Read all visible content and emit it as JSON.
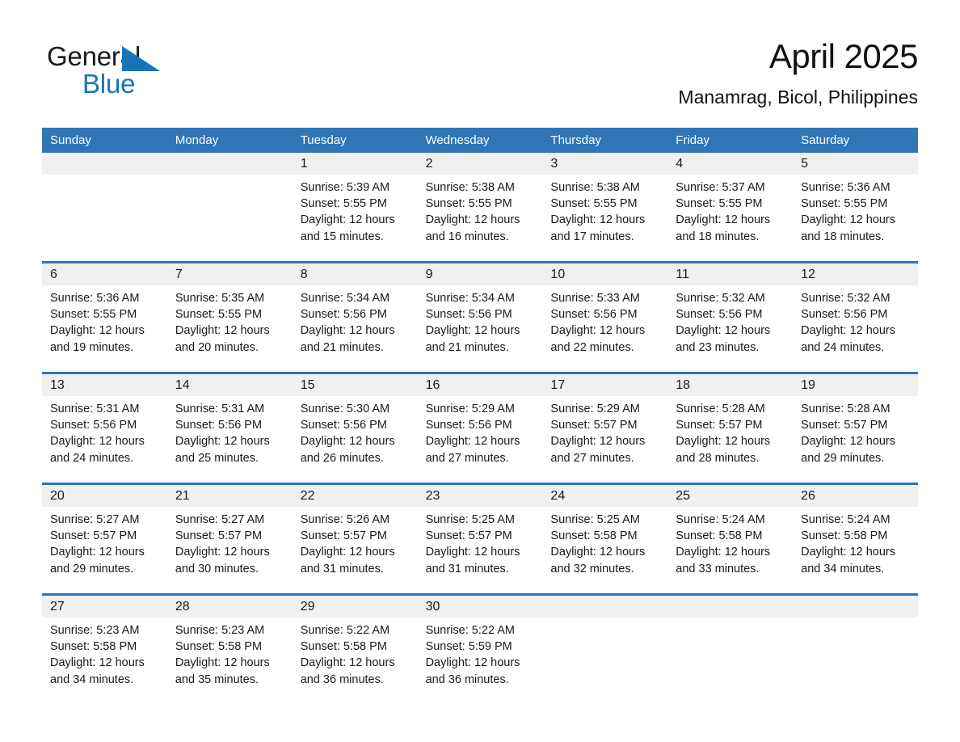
{
  "brand": {
    "name_part1": "General",
    "name_part2": "Blue",
    "triangle_icon": "triangle-icon",
    "accent_color": "#1874b8"
  },
  "header": {
    "title": "April 2025",
    "location": "Manamrag, Bicol, Philippines"
  },
  "colors": {
    "header_blue": "#3075b5",
    "rule_blue": "#2e74b5",
    "daynum_band": "#f0f0f0",
    "text": "#1a1a1a"
  },
  "weekdays": [
    "Sunday",
    "Monday",
    "Tuesday",
    "Wednesday",
    "Thursday",
    "Friday",
    "Saturday"
  ],
  "weeks": [
    {
      "days": [
        {
          "num": "",
          "sunrise": "",
          "sunset": "",
          "daylight_l1": "",
          "daylight_l2": ""
        },
        {
          "num": "",
          "sunrise": "",
          "sunset": "",
          "daylight_l1": "",
          "daylight_l2": ""
        },
        {
          "num": "1",
          "sunrise": "Sunrise: 5:39 AM",
          "sunset": "Sunset: 5:55 PM",
          "daylight_l1": "Daylight: 12 hours",
          "daylight_l2": "and 15 minutes."
        },
        {
          "num": "2",
          "sunrise": "Sunrise: 5:38 AM",
          "sunset": "Sunset: 5:55 PM",
          "daylight_l1": "Daylight: 12 hours",
          "daylight_l2": "and 16 minutes."
        },
        {
          "num": "3",
          "sunrise": "Sunrise: 5:38 AM",
          "sunset": "Sunset: 5:55 PM",
          "daylight_l1": "Daylight: 12 hours",
          "daylight_l2": "and 17 minutes."
        },
        {
          "num": "4",
          "sunrise": "Sunrise: 5:37 AM",
          "sunset": "Sunset: 5:55 PM",
          "daylight_l1": "Daylight: 12 hours",
          "daylight_l2": "and 18 minutes."
        },
        {
          "num": "5",
          "sunrise": "Sunrise: 5:36 AM",
          "sunset": "Sunset: 5:55 PM",
          "daylight_l1": "Daylight: 12 hours",
          "daylight_l2": "and 18 minutes."
        }
      ]
    },
    {
      "days": [
        {
          "num": "6",
          "sunrise": "Sunrise: 5:36 AM",
          "sunset": "Sunset: 5:55 PM",
          "daylight_l1": "Daylight: 12 hours",
          "daylight_l2": "and 19 minutes."
        },
        {
          "num": "7",
          "sunrise": "Sunrise: 5:35 AM",
          "sunset": "Sunset: 5:55 PM",
          "daylight_l1": "Daylight: 12 hours",
          "daylight_l2": "and 20 minutes."
        },
        {
          "num": "8",
          "sunrise": "Sunrise: 5:34 AM",
          "sunset": "Sunset: 5:56 PM",
          "daylight_l1": "Daylight: 12 hours",
          "daylight_l2": "and 21 minutes."
        },
        {
          "num": "9",
          "sunrise": "Sunrise: 5:34 AM",
          "sunset": "Sunset: 5:56 PM",
          "daylight_l1": "Daylight: 12 hours",
          "daylight_l2": "and 21 minutes."
        },
        {
          "num": "10",
          "sunrise": "Sunrise: 5:33 AM",
          "sunset": "Sunset: 5:56 PM",
          "daylight_l1": "Daylight: 12 hours",
          "daylight_l2": "and 22 minutes."
        },
        {
          "num": "11",
          "sunrise": "Sunrise: 5:32 AM",
          "sunset": "Sunset: 5:56 PM",
          "daylight_l1": "Daylight: 12 hours",
          "daylight_l2": "and 23 minutes."
        },
        {
          "num": "12",
          "sunrise": "Sunrise: 5:32 AM",
          "sunset": "Sunset: 5:56 PM",
          "daylight_l1": "Daylight: 12 hours",
          "daylight_l2": "and 24 minutes."
        }
      ]
    },
    {
      "days": [
        {
          "num": "13",
          "sunrise": "Sunrise: 5:31 AM",
          "sunset": "Sunset: 5:56 PM",
          "daylight_l1": "Daylight: 12 hours",
          "daylight_l2": "and 24 minutes."
        },
        {
          "num": "14",
          "sunrise": "Sunrise: 5:31 AM",
          "sunset": "Sunset: 5:56 PM",
          "daylight_l1": "Daylight: 12 hours",
          "daylight_l2": "and 25 minutes."
        },
        {
          "num": "15",
          "sunrise": "Sunrise: 5:30 AM",
          "sunset": "Sunset: 5:56 PM",
          "daylight_l1": "Daylight: 12 hours",
          "daylight_l2": "and 26 minutes."
        },
        {
          "num": "16",
          "sunrise": "Sunrise: 5:29 AM",
          "sunset": "Sunset: 5:56 PM",
          "daylight_l1": "Daylight: 12 hours",
          "daylight_l2": "and 27 minutes."
        },
        {
          "num": "17",
          "sunrise": "Sunrise: 5:29 AM",
          "sunset": "Sunset: 5:57 PM",
          "daylight_l1": "Daylight: 12 hours",
          "daylight_l2": "and 27 minutes."
        },
        {
          "num": "18",
          "sunrise": "Sunrise: 5:28 AM",
          "sunset": "Sunset: 5:57 PM",
          "daylight_l1": "Daylight: 12 hours",
          "daylight_l2": "and 28 minutes."
        },
        {
          "num": "19",
          "sunrise": "Sunrise: 5:28 AM",
          "sunset": "Sunset: 5:57 PM",
          "daylight_l1": "Daylight: 12 hours",
          "daylight_l2": "and 29 minutes."
        }
      ]
    },
    {
      "days": [
        {
          "num": "20",
          "sunrise": "Sunrise: 5:27 AM",
          "sunset": "Sunset: 5:57 PM",
          "daylight_l1": "Daylight: 12 hours",
          "daylight_l2": "and 29 minutes."
        },
        {
          "num": "21",
          "sunrise": "Sunrise: 5:27 AM",
          "sunset": "Sunset: 5:57 PM",
          "daylight_l1": "Daylight: 12 hours",
          "daylight_l2": "and 30 minutes."
        },
        {
          "num": "22",
          "sunrise": "Sunrise: 5:26 AM",
          "sunset": "Sunset: 5:57 PM",
          "daylight_l1": "Daylight: 12 hours",
          "daylight_l2": "and 31 minutes."
        },
        {
          "num": "23",
          "sunrise": "Sunrise: 5:25 AM",
          "sunset": "Sunset: 5:57 PM",
          "daylight_l1": "Daylight: 12 hours",
          "daylight_l2": "and 31 minutes."
        },
        {
          "num": "24",
          "sunrise": "Sunrise: 5:25 AM",
          "sunset": "Sunset: 5:58 PM",
          "daylight_l1": "Daylight: 12 hours",
          "daylight_l2": "and 32 minutes."
        },
        {
          "num": "25",
          "sunrise": "Sunrise: 5:24 AM",
          "sunset": "Sunset: 5:58 PM",
          "daylight_l1": "Daylight: 12 hours",
          "daylight_l2": "and 33 minutes."
        },
        {
          "num": "26",
          "sunrise": "Sunrise: 5:24 AM",
          "sunset": "Sunset: 5:58 PM",
          "daylight_l1": "Daylight: 12 hours",
          "daylight_l2": "and 34 minutes."
        }
      ]
    },
    {
      "days": [
        {
          "num": "27",
          "sunrise": "Sunrise: 5:23 AM",
          "sunset": "Sunset: 5:58 PM",
          "daylight_l1": "Daylight: 12 hours",
          "daylight_l2": "and 34 minutes."
        },
        {
          "num": "28",
          "sunrise": "Sunrise: 5:23 AM",
          "sunset": "Sunset: 5:58 PM",
          "daylight_l1": "Daylight: 12 hours",
          "daylight_l2": "and 35 minutes."
        },
        {
          "num": "29",
          "sunrise": "Sunrise: 5:22 AM",
          "sunset": "Sunset: 5:58 PM",
          "daylight_l1": "Daylight: 12 hours",
          "daylight_l2": "and 36 minutes."
        },
        {
          "num": "30",
          "sunrise": "Sunrise: 5:22 AM",
          "sunset": "Sunset: 5:59 PM",
          "daylight_l1": "Daylight: 12 hours",
          "daylight_l2": "and 36 minutes."
        },
        {
          "num": "",
          "sunrise": "",
          "sunset": "",
          "daylight_l1": "",
          "daylight_l2": ""
        },
        {
          "num": "",
          "sunrise": "",
          "sunset": "",
          "daylight_l1": "",
          "daylight_l2": ""
        },
        {
          "num": "",
          "sunrise": "",
          "sunset": "",
          "daylight_l1": "",
          "daylight_l2": ""
        }
      ]
    }
  ]
}
